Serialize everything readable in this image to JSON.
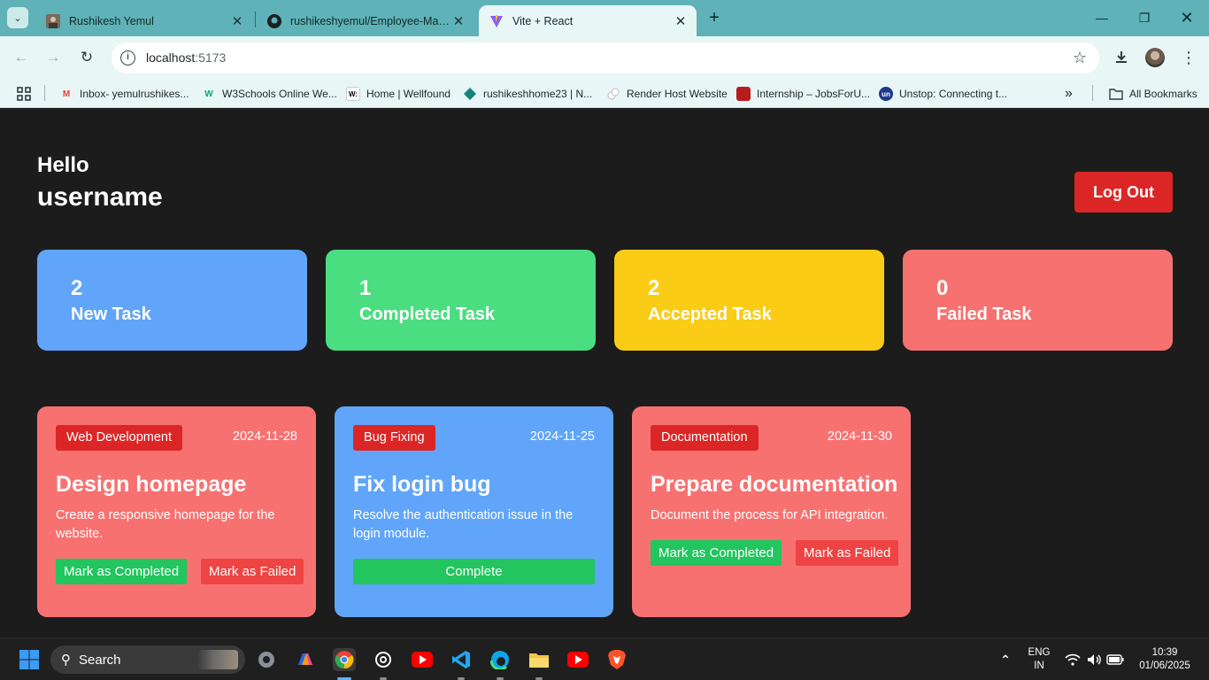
{
  "browser": {
    "tabs": [
      {
        "title": "Rushikesh Yemul",
        "active": false
      },
      {
        "title": "rushikeshyemul/Employee-Management",
        "active": false
      },
      {
        "title": "Vite + React",
        "active": true
      }
    ],
    "url_host": "localhost",
    "url_port": ":5173",
    "bookmarks": [
      {
        "label": "Inbox- yemulrushikes...",
        "icon": "gmail-icon"
      },
      {
        "label": "W3Schools Online We...",
        "icon": "w3schools-icon"
      },
      {
        "label": "Home | Wellfound",
        "icon": "wellfound-icon"
      },
      {
        "label": "rushikeshhome23 | N...",
        "icon": "netlify-icon"
      },
      {
        "label": "Render Host Website",
        "icon": "render-icon"
      },
      {
        "label": "Internship – JobsForU...",
        "icon": "jobsforu-icon"
      },
      {
        "label": "Unstop: Connecting t...",
        "icon": "unstop-icon"
      }
    ],
    "all_bookmarks": "All Bookmarks"
  },
  "header": {
    "greeting": "Hello",
    "username": "username",
    "logout_label": "Log Out"
  },
  "stats": [
    {
      "count": "2",
      "label": "New Task",
      "color": "#60a5fa"
    },
    {
      "count": "1",
      "label": "Completed Task",
      "color": "#4ade80"
    },
    {
      "count": "2",
      "label": "Accepted Task",
      "color": "#facc15"
    },
    {
      "count": "0",
      "label": "Failed Task",
      "color": "#f87171"
    }
  ],
  "tasks": [
    {
      "category": "Web Development",
      "date": "2024-11-28",
      "title": "Design homepage",
      "description": "Create a responsive homepage for the website.",
      "color": "#f87171",
      "buttons": [
        "Mark as Completed",
        "Mark as Failed"
      ]
    },
    {
      "category": "Bug Fixing",
      "date": "2024-11-25",
      "title": "Fix login bug",
      "description": "Resolve the authentication issue in the login module.",
      "color": "#60a5fa",
      "buttons": [
        "Complete"
      ]
    },
    {
      "category": "Documentation",
      "date": "2024-11-30",
      "title": "Prepare documentation",
      "description": "Document the process for API integration.",
      "color": "#f87171",
      "buttons": [
        "Mark as Completed",
        "Mark as Failed"
      ]
    }
  ],
  "taskbar": {
    "search_label": "Search",
    "language": "ENG",
    "region": "IN",
    "time": "10:39",
    "date": "01/06/2025"
  }
}
